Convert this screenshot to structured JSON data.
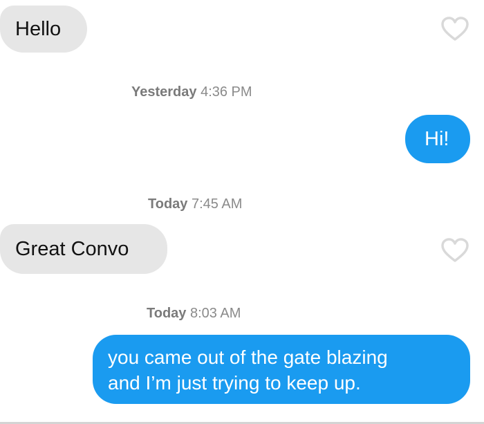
{
  "messages": [
    {
      "kind": "incoming",
      "text": "Hello"
    },
    {
      "kind": "timestamp",
      "day": "Yesterday",
      "time": "4:36 PM"
    },
    {
      "kind": "outgoing",
      "text": "Hi!"
    },
    {
      "kind": "timestamp",
      "day": "Today",
      "time": "7:45 AM"
    },
    {
      "kind": "incoming",
      "text": "Great Convo"
    },
    {
      "kind": "timestamp",
      "day": "Today",
      "time": "8:03 AM"
    },
    {
      "kind": "outgoing",
      "line1": "you came out of the gate blazing",
      "line2": "and I’m just trying to keep up."
    }
  ],
  "icons": {
    "like": "heart-outline-icon"
  },
  "colors": {
    "outgoing_bubble": "#1a9bf0",
    "incoming_bubble": "#e6e6e6",
    "timestamp": "#8a8a8a",
    "heart": "#d9d9d9"
  }
}
